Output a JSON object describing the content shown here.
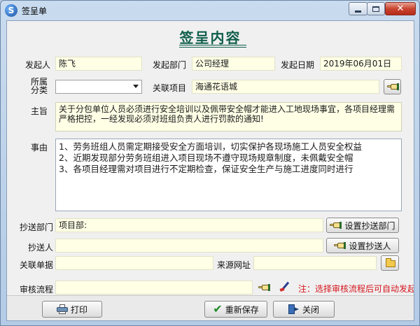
{
  "window": {
    "title": "签呈单",
    "app_icon_glyph": "S",
    "close_glyph": "✕"
  },
  "header": {
    "title": "签呈内容"
  },
  "form": {
    "initiator": {
      "label": "发起人",
      "value": "陈飞"
    },
    "department": {
      "label": "发起部门",
      "value": "公司经理"
    },
    "date": {
      "label": "发起日期",
      "value": "2019年06月01日"
    },
    "category": {
      "label_line1": "所属",
      "label_line2": "分类",
      "value": ""
    },
    "project": {
      "label": "关联项目",
      "value": "海通花语城"
    },
    "subject": {
      "label": "主旨",
      "value": "关于分包单位人员必须进行安全培训以及佩带安全帽才能进入工地现场事宜，各项目经理需严格把控，一经发现必须对班组负责人进行罚款的通知!"
    },
    "reason": {
      "label": "事由",
      "lines": [
        "1、劳务班组人员需定期接受安全方面培训，切实保护各现场施工人员安全权益",
        "2、近期发现部分劳务班组进入项目现场不遵守现场规章制度，未佩戴安全帽",
        "3、各项目经理需对项目进行不定期检查，保证安全生产与施工进度同时进行"
      ]
    },
    "cc_department": {
      "label": "抄送部门",
      "value": "项目部:",
      "button_label": "设置抄送部门"
    },
    "cc_person": {
      "label": "抄送人",
      "value": "",
      "button_label": "设置抄送人"
    },
    "related_doc": {
      "label": "关联单据",
      "value": ""
    },
    "source_url": {
      "label": "来源网址",
      "value": ""
    },
    "workflow": {
      "label": "审核流程",
      "value": "",
      "note": "注：选择审核流程后可自动发起"
    }
  },
  "footer": {
    "print_label": "打印",
    "resave_label": "重新保存",
    "close_label": "关闭"
  },
  "icons": {
    "pick": "hand-pointer-icon",
    "folder": "folder-icon",
    "pen": "signature-pen-icon",
    "print": "printer-icon",
    "save": "checkmark-icon",
    "exit": "exit-door-icon"
  },
  "colors": {
    "field_bg": "#ffffe6",
    "title_green": "#0f5e4b",
    "note_red": "#d4161d"
  }
}
